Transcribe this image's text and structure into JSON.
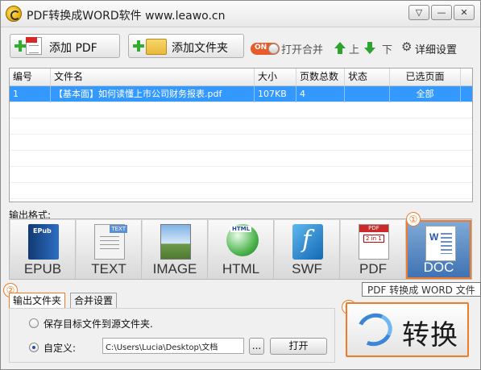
{
  "window": {
    "title": "PDF转换成WORD软件 www.leawo.cn",
    "menu_glyph": "▽",
    "minimize_glyph": "—",
    "close_glyph": "✕"
  },
  "toolbar": {
    "add_pdf": "添加 PDF",
    "add_folder": "添加文件夹",
    "toggle_state": "ON",
    "merge": "打开合并",
    "up": "上",
    "down": "下",
    "settings_glyph": "⚙",
    "settings": "详细设置"
  },
  "table": {
    "columns": [
      "编号",
      "文件名",
      "大小",
      "页数总数",
      "状态",
      "已选页面"
    ],
    "rows": [
      {
        "no": "1",
        "name": "【基本面】如何读懂上市公司财务报表.pdf",
        "size": "107KB",
        "pages": "4",
        "status": "",
        "selected": "全部"
      }
    ]
  },
  "output_format": {
    "label": "输出格式:",
    "formats": [
      "EPUB",
      "TEXT",
      "IMAGE",
      "HTML",
      "SWF",
      "PDF",
      "DOC"
    ],
    "selected": "DOC",
    "tooltip": "PDF 转换成 WORD 文件"
  },
  "badges": [
    "①",
    "②",
    "③"
  ],
  "tabs": [
    "输出文件夹",
    "合并设置"
  ],
  "output_options": {
    "save_to_source": "保存目标文件到源文件夹.",
    "custom": "自定义:",
    "path": "C:\\Users\\Lucia\\Desktop\\文档",
    "browse": "...",
    "open": "打开"
  },
  "convert_label": "转换",
  "colors": {
    "accent": "#f07b2a",
    "selection": "#3399ff",
    "green": "#2ea22e"
  }
}
